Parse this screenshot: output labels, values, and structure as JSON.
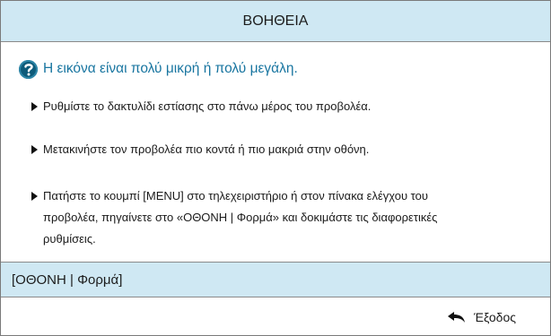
{
  "header": {
    "title": "ΒΟΗΘΕΙΑ"
  },
  "issue": {
    "icon": "question-icon",
    "text": "Η εικόνα είναι πολύ μικρή ή πολύ μεγάλη."
  },
  "steps": [
    {
      "text": "Ρυθμίστε το δακτυλίδι εστίασης στο πάνω μέρος του προβολέα."
    },
    {
      "text": "Μετακινήστε τον προβολέα πιο κοντά ή πιο μακριά στην οθόνη."
    },
    {
      "text": "Πατήστε το κουμπί [MENU] στο τηλεχειριστήριο ή στον πίνακα ελέγχου του προβολέα, πηγαίνετε στο «ΟΘΟΝΗ | Φορμά» και δοκιμάστε τις διαφορετικές ρυθμίσεις."
    }
  ],
  "path": {
    "label": "[ΟΘΟΝΗ | Φορμά]"
  },
  "footer": {
    "exit_icon": "return-arrow-icon",
    "exit_label": "Έξοδος"
  },
  "colors": {
    "header_bg": "#cfe8f3",
    "issue_text": "#1875a0",
    "icon_bg": "#0e5b7a"
  }
}
